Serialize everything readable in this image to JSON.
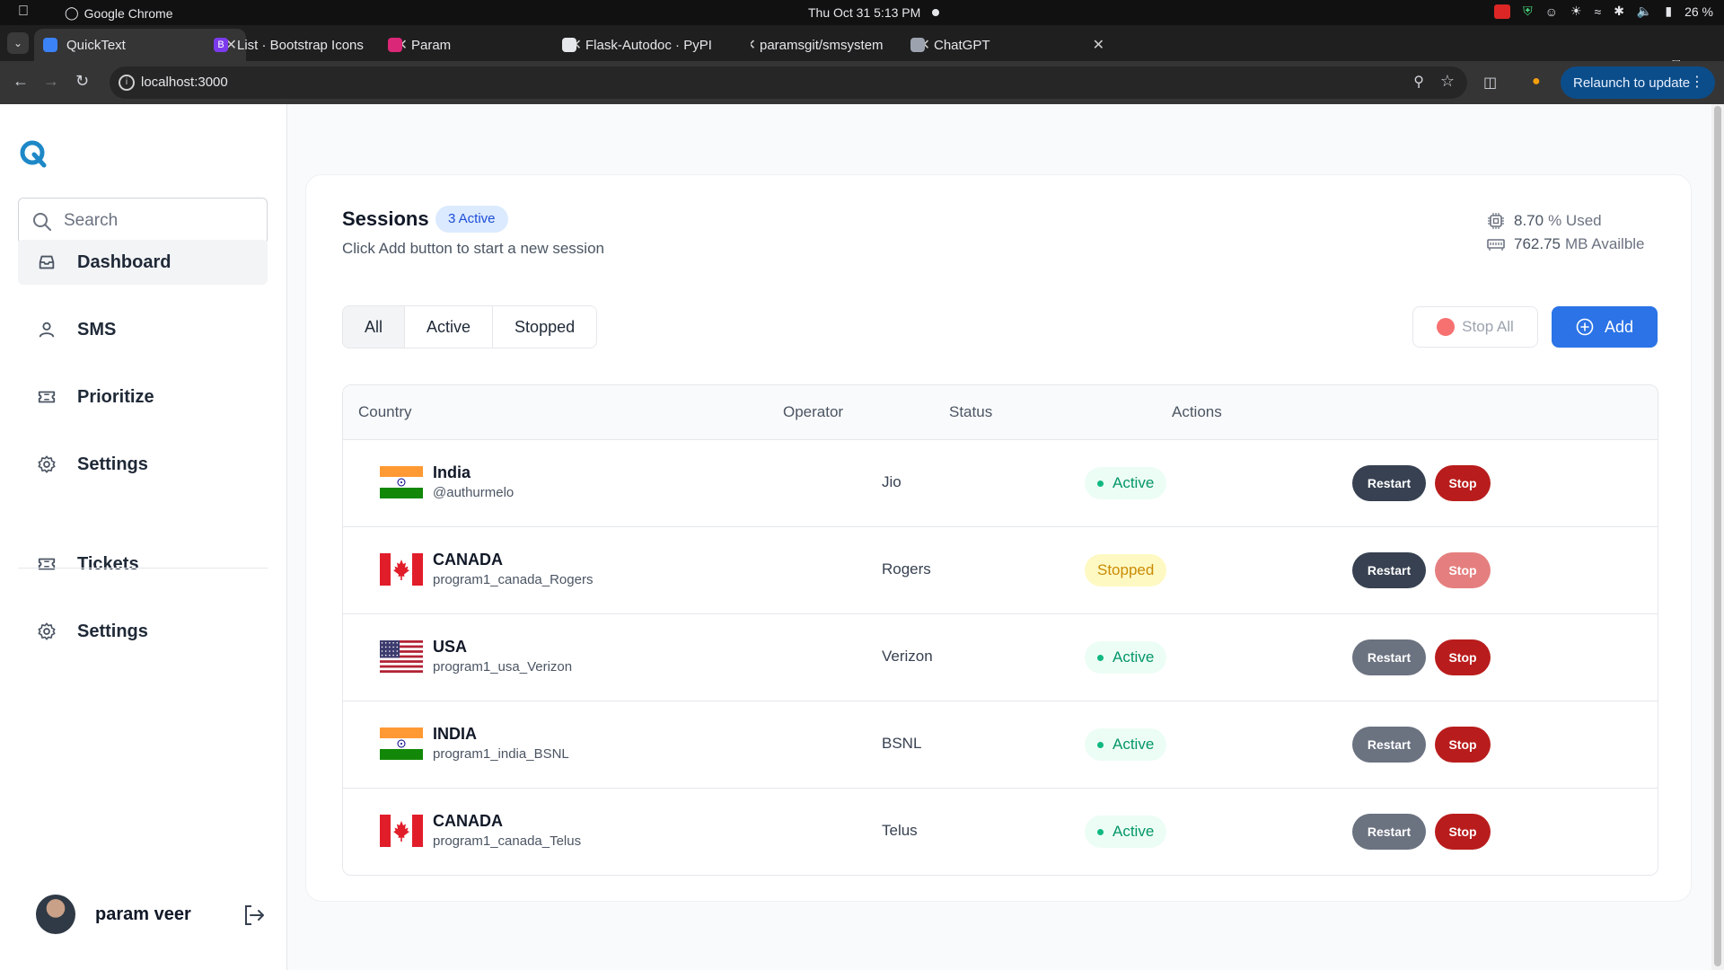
{
  "os": {
    "app_name": "Google Chrome",
    "clock": "Thu Oct 31   5:13 PM",
    "battery": "26 %"
  },
  "browser": {
    "tabs": [
      {
        "title": "QuickText",
        "active": true,
        "favicon_color": "#3b82f6",
        "favicon_glyph": ""
      },
      {
        "title": "List · Bootstrap Icons",
        "active": false,
        "favicon_color": "#7c3aed",
        "favicon_glyph": "B"
      },
      {
        "title": "Param",
        "active": false,
        "favicon_color": "#db2777",
        "favicon_glyph": ""
      },
      {
        "title": "Flask-Autodoc · PyPI",
        "active": false,
        "favicon_color": "#e5e7eb",
        "favicon_glyph": ""
      },
      {
        "title": "paramsgit/smsystem",
        "active": false,
        "favicon_color": "#1f1f1f",
        "favicon_glyph": ""
      },
      {
        "title": "ChatGPT",
        "active": false,
        "favicon_color": "#9ca3af",
        "favicon_glyph": ""
      }
    ],
    "url": "localhost:3000",
    "relaunch_label": "Relaunch to update"
  },
  "sidebar": {
    "search_placeholder": "Search",
    "items": [
      {
        "label": "Dashboard",
        "icon": "inbox-icon",
        "active": true
      },
      {
        "label": "SMS",
        "icon": "person-icon",
        "active": false
      },
      {
        "label": "Prioritize",
        "icon": "ticket-icon",
        "active": false
      },
      {
        "label": "Settings",
        "icon": "gear-icon",
        "active": false
      },
      {
        "label": "Tickets",
        "icon": "ticket-icon",
        "active": false
      },
      {
        "label": "Settings",
        "icon": "gear-icon",
        "active": false
      }
    ],
    "user_name": "param veer"
  },
  "main": {
    "title": "Sessions",
    "active_badge": "3 Active",
    "subtitle": "Click Add button to start a new session",
    "stats": {
      "cpu_value": "8.70",
      "cpu_label": "% Used",
      "memory_value": "762.75",
      "memory_label": "MB Availble"
    },
    "filters": [
      {
        "label": "All",
        "selected": true
      },
      {
        "label": "Active",
        "selected": false
      },
      {
        "label": "Stopped",
        "selected": false
      }
    ],
    "stop_all_label": "Stop All",
    "add_label": "Add",
    "table": {
      "columns": [
        "Country",
        "Operator",
        "Status",
        "Actions"
      ],
      "rows": [
        {
          "country": "India",
          "handle": "@authurmelo",
          "flag": "india",
          "operator": "Jio",
          "status": "Active",
          "restart_label": "Restart",
          "stop_label": "Stop"
        },
        {
          "country": "CANADA",
          "handle": "program1_canada_Rogers",
          "flag": "canada",
          "operator": "Rogers",
          "status": "Stopped",
          "restart_label": "Restart",
          "stop_label": "Stop"
        },
        {
          "country": "USA",
          "handle": "program1_usa_Verizon",
          "flag": "usa",
          "operator": "Verizon",
          "status": "Active",
          "restart_label": "Restart",
          "stop_label": "Stop"
        },
        {
          "country": "INDIA",
          "handle": "program1_india_BSNL",
          "flag": "india",
          "operator": "BSNL",
          "status": "Active",
          "restart_label": "Restart",
          "stop_label": "Stop"
        },
        {
          "country": "CANADA",
          "handle": "program1_canada_Telus",
          "flag": "canada",
          "operator": "Telus",
          "status": "Active",
          "restart_label": "Restart",
          "stop_label": "Stop"
        }
      ]
    }
  },
  "colors": {
    "primary": "#2b73e6",
    "danger": "#b91c1c",
    "success": "#059669",
    "warning": "#ca8a04"
  }
}
